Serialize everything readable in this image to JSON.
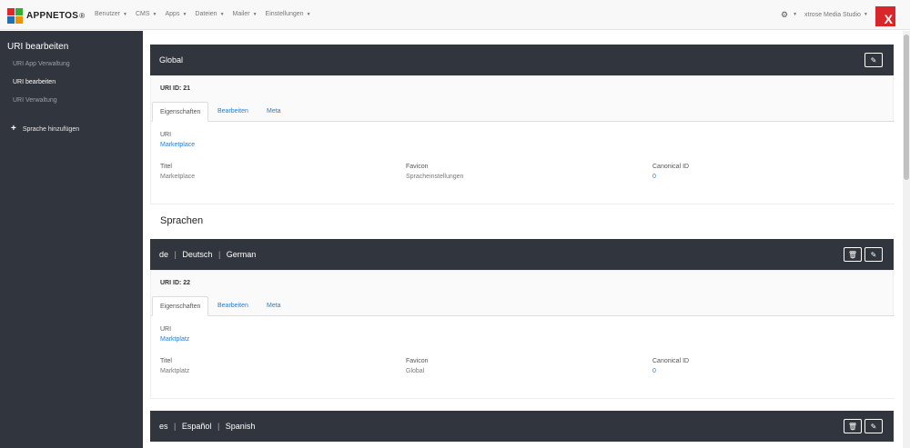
{
  "brand": {
    "name": "APPNETOS",
    "sup": "®"
  },
  "nav": {
    "items": [
      "Benutzer",
      "CMS",
      "Apps",
      "Dateien",
      "Mailer",
      "Einstellungen"
    ],
    "studio": "xtrose Media Studio",
    "x_logo": "X",
    "icons": {
      "settings": "gear-icon",
      "dropdown": "caret-down-icon"
    }
  },
  "sidebar": {
    "title": "URI bearbeiten",
    "links": [
      "URI App Verwaltung",
      "URI bearbeiten",
      "URI Verwaltung"
    ],
    "add_language": "Sprache hinzufügen"
  },
  "global_panel": {
    "title": "Global",
    "uri_id": "URI ID: 21",
    "tabs": [
      "Eigenschaften",
      "Bearbeiten",
      "Meta"
    ],
    "uri_label": "URI",
    "uri_value": "Marketplace",
    "fields": [
      {
        "label": "Titel",
        "value": "Marketplace"
      },
      {
        "label": "Favicon",
        "value": "Spracheinstellungen"
      },
      {
        "label": "Canonical ID",
        "value": "0"
      }
    ]
  },
  "languages_title": "Sprachen",
  "de_panel": {
    "code": "de",
    "native": "Deutsch",
    "english": "German",
    "uri_id": "URI ID: 22",
    "tabs": [
      "Eigenschaften",
      "Bearbeiten",
      "Meta"
    ],
    "uri_label": "URI",
    "uri_value": "Marktplatz",
    "fields": [
      {
        "label": "Titel",
        "value": "Marktplatz"
      },
      {
        "label": "Favicon",
        "value": "Global"
      },
      {
        "label": "Canonical ID",
        "value": "0"
      }
    ]
  },
  "es_panel": {
    "code": "es",
    "native": "Español",
    "english": "Spanish"
  },
  "separator": "|",
  "colors": {
    "panel_header": "#31353d",
    "link": "#2a7ec8",
    "sidebar": "#31353d",
    "logo_red": "#d8262b"
  }
}
